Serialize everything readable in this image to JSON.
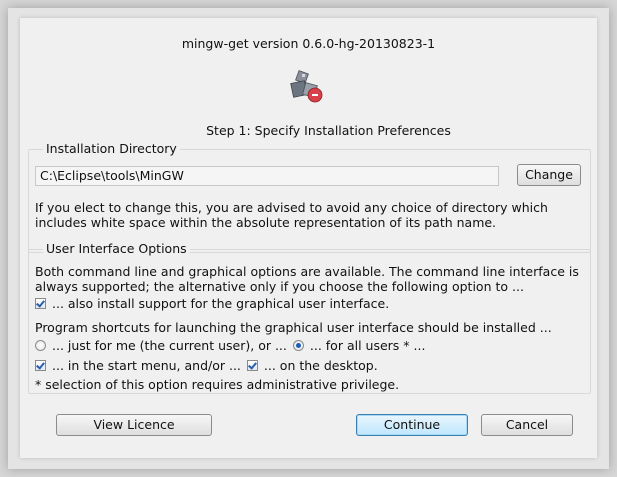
{
  "dialog": {
    "version_text": "mingw-get version 0.6.0-hg-20130823-1",
    "step_title": "Step 1: Specify Installation Preferences",
    "logo_icon": "mingw-installer-icon"
  },
  "installation_directory": {
    "label": "Installation Directory",
    "path_value": "C:\\Eclipse\\tools\\MinGW",
    "change_label": "Change",
    "advice_text": "If you elect to change this, you are advised to avoid any choice of directory which includes white space within the absolute representation of its path name."
  },
  "ui_options": {
    "label": "User Interface Options",
    "intro_text": "Both command line and graphical options are available.  The command line interface is always supported; the alternative only if you choose the following option to ...",
    "gui_support": {
      "checked": true,
      "label": "... also install support for the graphical user interface."
    },
    "shortcuts_text": "Program shortcuts for launching the graphical user interface should be installed ...",
    "just_for_me": {
      "selected": false,
      "label": "... just for me (the current user), or ..."
    },
    "all_users": {
      "selected": true,
      "label": "... for all users * ..."
    },
    "start_menu": {
      "checked": true,
      "label": "... in the start menu, and/or ..."
    },
    "desktop": {
      "checked": true,
      "label": "... on the desktop."
    },
    "note_text": "*  selection of this option requires administrative privilege."
  },
  "footer": {
    "view_licence_label": "View Licence",
    "continue_label": "Continue",
    "cancel_label": "Cancel"
  },
  "colors": {
    "dialog_bg": "#f0f0f0",
    "default_button": "#bee6fd",
    "check_mark": "#2a5fa8"
  }
}
